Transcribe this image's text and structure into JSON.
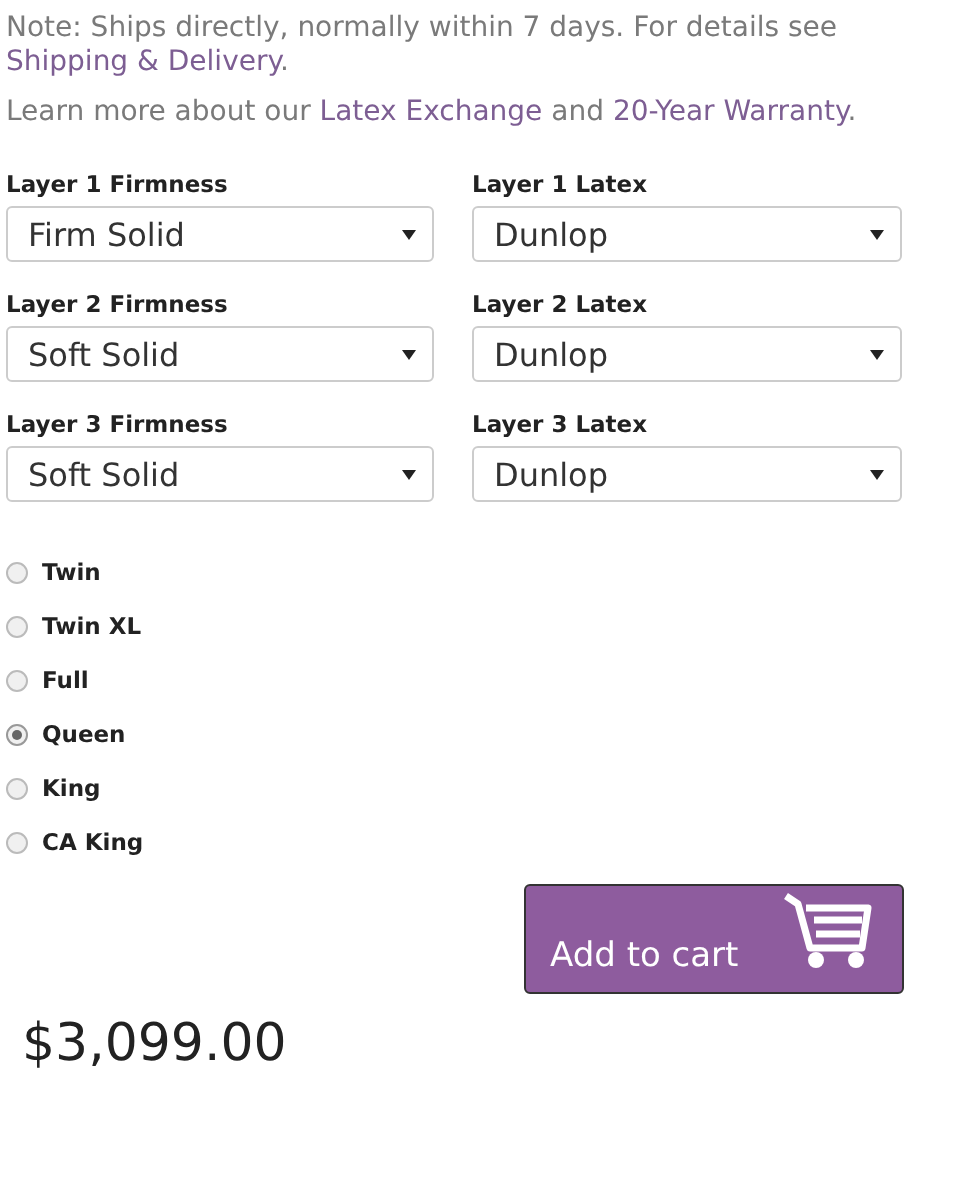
{
  "notes": [
    {
      "parts": [
        {
          "kind": "text",
          "text": "Note: Ships directly, normally within 7 days. For details see "
        },
        {
          "kind": "link",
          "text": "Shipping & Delivery"
        },
        {
          "kind": "text",
          "text": "."
        }
      ]
    },
    {
      "parts": [
        {
          "kind": "text",
          "text": "Learn more about our "
        },
        {
          "kind": "link",
          "text": "Latex Exchange"
        },
        {
          "kind": "text",
          "text": " and "
        },
        {
          "kind": "link",
          "text": "20-Year Warranty"
        },
        {
          "kind": "text",
          "text": "."
        }
      ]
    }
  ],
  "layers": [
    {
      "firmness_label": "Layer 1 Firmness",
      "firmness": "Firm Solid",
      "latex_label": "Layer 1 Latex",
      "latex": "Dunlop"
    },
    {
      "firmness_label": "Layer 2 Firmness",
      "firmness": "Soft Solid",
      "latex_label": "Layer 2 Latex",
      "latex": "Dunlop"
    },
    {
      "firmness_label": "Layer 3 Firmness",
      "firmness": "Soft Solid",
      "latex_label": "Layer 3 Latex",
      "latex": "Dunlop"
    }
  ],
  "sizes": [
    {
      "label": "Twin",
      "selected": false
    },
    {
      "label": "Twin XL",
      "selected": false
    },
    {
      "label": "Full",
      "selected": false
    },
    {
      "label": "Queen",
      "selected": true
    },
    {
      "label": "King",
      "selected": false
    },
    {
      "label": "CA King",
      "selected": false
    }
  ],
  "add_to_cart": "Add to cart",
  "price": "$3,099.00"
}
